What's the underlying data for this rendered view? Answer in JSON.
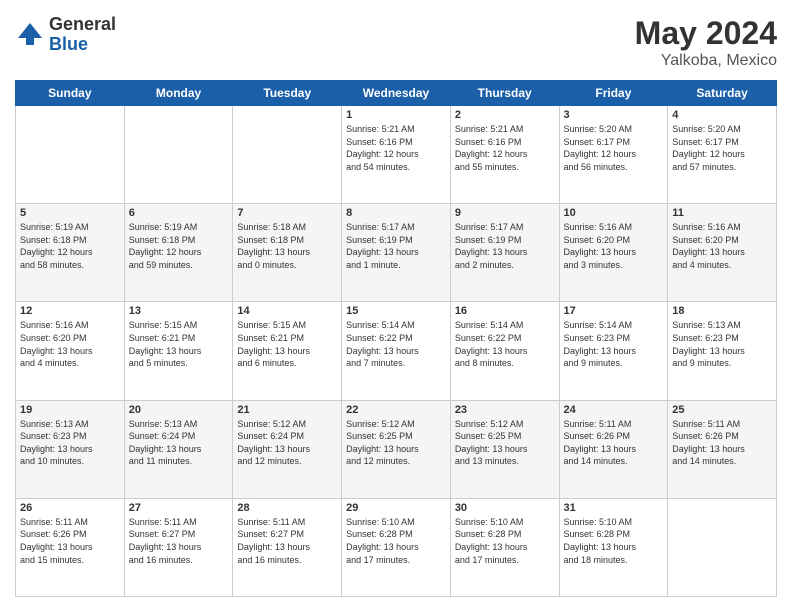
{
  "header": {
    "logo_general": "General",
    "logo_blue": "Blue",
    "main_title": "May 2024",
    "subtitle": "Yalkoba, Mexico"
  },
  "days_of_week": [
    "Sunday",
    "Monday",
    "Tuesday",
    "Wednesday",
    "Thursday",
    "Friday",
    "Saturday"
  ],
  "weeks": [
    [
      {
        "day": "",
        "info": ""
      },
      {
        "day": "",
        "info": ""
      },
      {
        "day": "",
        "info": ""
      },
      {
        "day": "1",
        "info": "Sunrise: 5:21 AM\nSunset: 6:16 PM\nDaylight: 12 hours\nand 54 minutes."
      },
      {
        "day": "2",
        "info": "Sunrise: 5:21 AM\nSunset: 6:16 PM\nDaylight: 12 hours\nand 55 minutes."
      },
      {
        "day": "3",
        "info": "Sunrise: 5:20 AM\nSunset: 6:17 PM\nDaylight: 12 hours\nand 56 minutes."
      },
      {
        "day": "4",
        "info": "Sunrise: 5:20 AM\nSunset: 6:17 PM\nDaylight: 12 hours\nand 57 minutes."
      }
    ],
    [
      {
        "day": "5",
        "info": "Sunrise: 5:19 AM\nSunset: 6:18 PM\nDaylight: 12 hours\nand 58 minutes."
      },
      {
        "day": "6",
        "info": "Sunrise: 5:19 AM\nSunset: 6:18 PM\nDaylight: 12 hours\nand 59 minutes."
      },
      {
        "day": "7",
        "info": "Sunrise: 5:18 AM\nSunset: 6:18 PM\nDaylight: 13 hours\nand 0 minutes."
      },
      {
        "day": "8",
        "info": "Sunrise: 5:17 AM\nSunset: 6:19 PM\nDaylight: 13 hours\nand 1 minute."
      },
      {
        "day": "9",
        "info": "Sunrise: 5:17 AM\nSunset: 6:19 PM\nDaylight: 13 hours\nand 2 minutes."
      },
      {
        "day": "10",
        "info": "Sunrise: 5:16 AM\nSunset: 6:20 PM\nDaylight: 13 hours\nand 3 minutes."
      },
      {
        "day": "11",
        "info": "Sunrise: 5:16 AM\nSunset: 6:20 PM\nDaylight: 13 hours\nand 4 minutes."
      }
    ],
    [
      {
        "day": "12",
        "info": "Sunrise: 5:16 AM\nSunset: 6:20 PM\nDaylight: 13 hours\nand 4 minutes."
      },
      {
        "day": "13",
        "info": "Sunrise: 5:15 AM\nSunset: 6:21 PM\nDaylight: 13 hours\nand 5 minutes."
      },
      {
        "day": "14",
        "info": "Sunrise: 5:15 AM\nSunset: 6:21 PM\nDaylight: 13 hours\nand 6 minutes."
      },
      {
        "day": "15",
        "info": "Sunrise: 5:14 AM\nSunset: 6:22 PM\nDaylight: 13 hours\nand 7 minutes."
      },
      {
        "day": "16",
        "info": "Sunrise: 5:14 AM\nSunset: 6:22 PM\nDaylight: 13 hours\nand 8 minutes."
      },
      {
        "day": "17",
        "info": "Sunrise: 5:14 AM\nSunset: 6:23 PM\nDaylight: 13 hours\nand 9 minutes."
      },
      {
        "day": "18",
        "info": "Sunrise: 5:13 AM\nSunset: 6:23 PM\nDaylight: 13 hours\nand 9 minutes."
      }
    ],
    [
      {
        "day": "19",
        "info": "Sunrise: 5:13 AM\nSunset: 6:23 PM\nDaylight: 13 hours\nand 10 minutes."
      },
      {
        "day": "20",
        "info": "Sunrise: 5:13 AM\nSunset: 6:24 PM\nDaylight: 13 hours\nand 11 minutes."
      },
      {
        "day": "21",
        "info": "Sunrise: 5:12 AM\nSunset: 6:24 PM\nDaylight: 13 hours\nand 12 minutes."
      },
      {
        "day": "22",
        "info": "Sunrise: 5:12 AM\nSunset: 6:25 PM\nDaylight: 13 hours\nand 12 minutes."
      },
      {
        "day": "23",
        "info": "Sunrise: 5:12 AM\nSunset: 6:25 PM\nDaylight: 13 hours\nand 13 minutes."
      },
      {
        "day": "24",
        "info": "Sunrise: 5:11 AM\nSunset: 6:26 PM\nDaylight: 13 hours\nand 14 minutes."
      },
      {
        "day": "25",
        "info": "Sunrise: 5:11 AM\nSunset: 6:26 PM\nDaylight: 13 hours\nand 14 minutes."
      }
    ],
    [
      {
        "day": "26",
        "info": "Sunrise: 5:11 AM\nSunset: 6:26 PM\nDaylight: 13 hours\nand 15 minutes."
      },
      {
        "day": "27",
        "info": "Sunrise: 5:11 AM\nSunset: 6:27 PM\nDaylight: 13 hours\nand 16 minutes."
      },
      {
        "day": "28",
        "info": "Sunrise: 5:11 AM\nSunset: 6:27 PM\nDaylight: 13 hours\nand 16 minutes."
      },
      {
        "day": "29",
        "info": "Sunrise: 5:10 AM\nSunset: 6:28 PM\nDaylight: 13 hours\nand 17 minutes."
      },
      {
        "day": "30",
        "info": "Sunrise: 5:10 AM\nSunset: 6:28 PM\nDaylight: 13 hours\nand 17 minutes."
      },
      {
        "day": "31",
        "info": "Sunrise: 5:10 AM\nSunset: 6:28 PM\nDaylight: 13 hours\nand 18 minutes."
      },
      {
        "day": "",
        "info": ""
      }
    ]
  ]
}
